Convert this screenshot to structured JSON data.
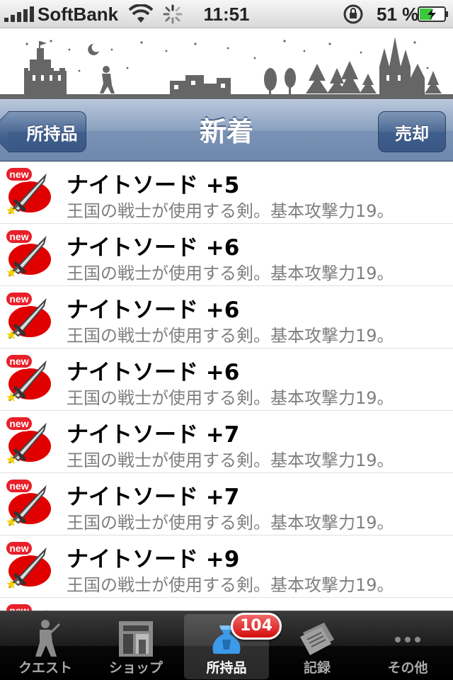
{
  "status_bar": {
    "carrier": "SoftBank",
    "time": "11:51",
    "battery_percent": "51 %",
    "battery_level": 0.51,
    "icons": [
      "signal-icon",
      "wifi-icon",
      "activity-spinner-icon",
      "rotation-lock-icon",
      "battery-charging-icon"
    ]
  },
  "nav": {
    "back_label": "所持品",
    "title": "新着",
    "sell_label": "売却"
  },
  "items": [
    {
      "badge": "new",
      "name": "ナイトソード +5",
      "desc": "王国の戦士が使用する剣。基本攻撃力19。",
      "stars": 1
    },
    {
      "badge": "new",
      "name": "ナイトソード +6",
      "desc": "王国の戦士が使用する剣。基本攻撃力19。",
      "stars": 1
    },
    {
      "badge": "new",
      "name": "ナイトソード +6",
      "desc": "王国の戦士が使用する剣。基本攻撃力19。",
      "stars": 1
    },
    {
      "badge": "new",
      "name": "ナイトソード +6",
      "desc": "王国の戦士が使用する剣。基本攻撃力19。",
      "stars": 1
    },
    {
      "badge": "new",
      "name": "ナイトソード +7",
      "desc": "王国の戦士が使用する剣。基本攻撃力19。",
      "stars": 1
    },
    {
      "badge": "new",
      "name": "ナイトソード +7",
      "desc": "王国の戦士が使用する剣。基本攻撃力19。",
      "stars": 1
    },
    {
      "badge": "new",
      "name": "ナイトソード +9",
      "desc": "王国の戦士が使用する剣。基本攻撃力19。",
      "stars": 1
    },
    {
      "badge": "new",
      "name": "",
      "desc": "",
      "stars": 1
    }
  ],
  "tabs": [
    {
      "label": "クエスト",
      "icon": "knight-icon",
      "selected": false
    },
    {
      "label": "ショップ",
      "icon": "shop-icon",
      "selected": false
    },
    {
      "label": "所持品",
      "icon": "bag-icon",
      "selected": true,
      "badge": "104"
    },
    {
      "label": "記録",
      "icon": "notebook-icon",
      "selected": false
    },
    {
      "label": "その他",
      "icon": "more-icon",
      "selected": false
    }
  ],
  "colors": {
    "nav_blue": "#6d88ad",
    "badge_red": "#d40d0d",
    "item_icon_red": "#e00000",
    "star_yellow": "#f5d000"
  }
}
